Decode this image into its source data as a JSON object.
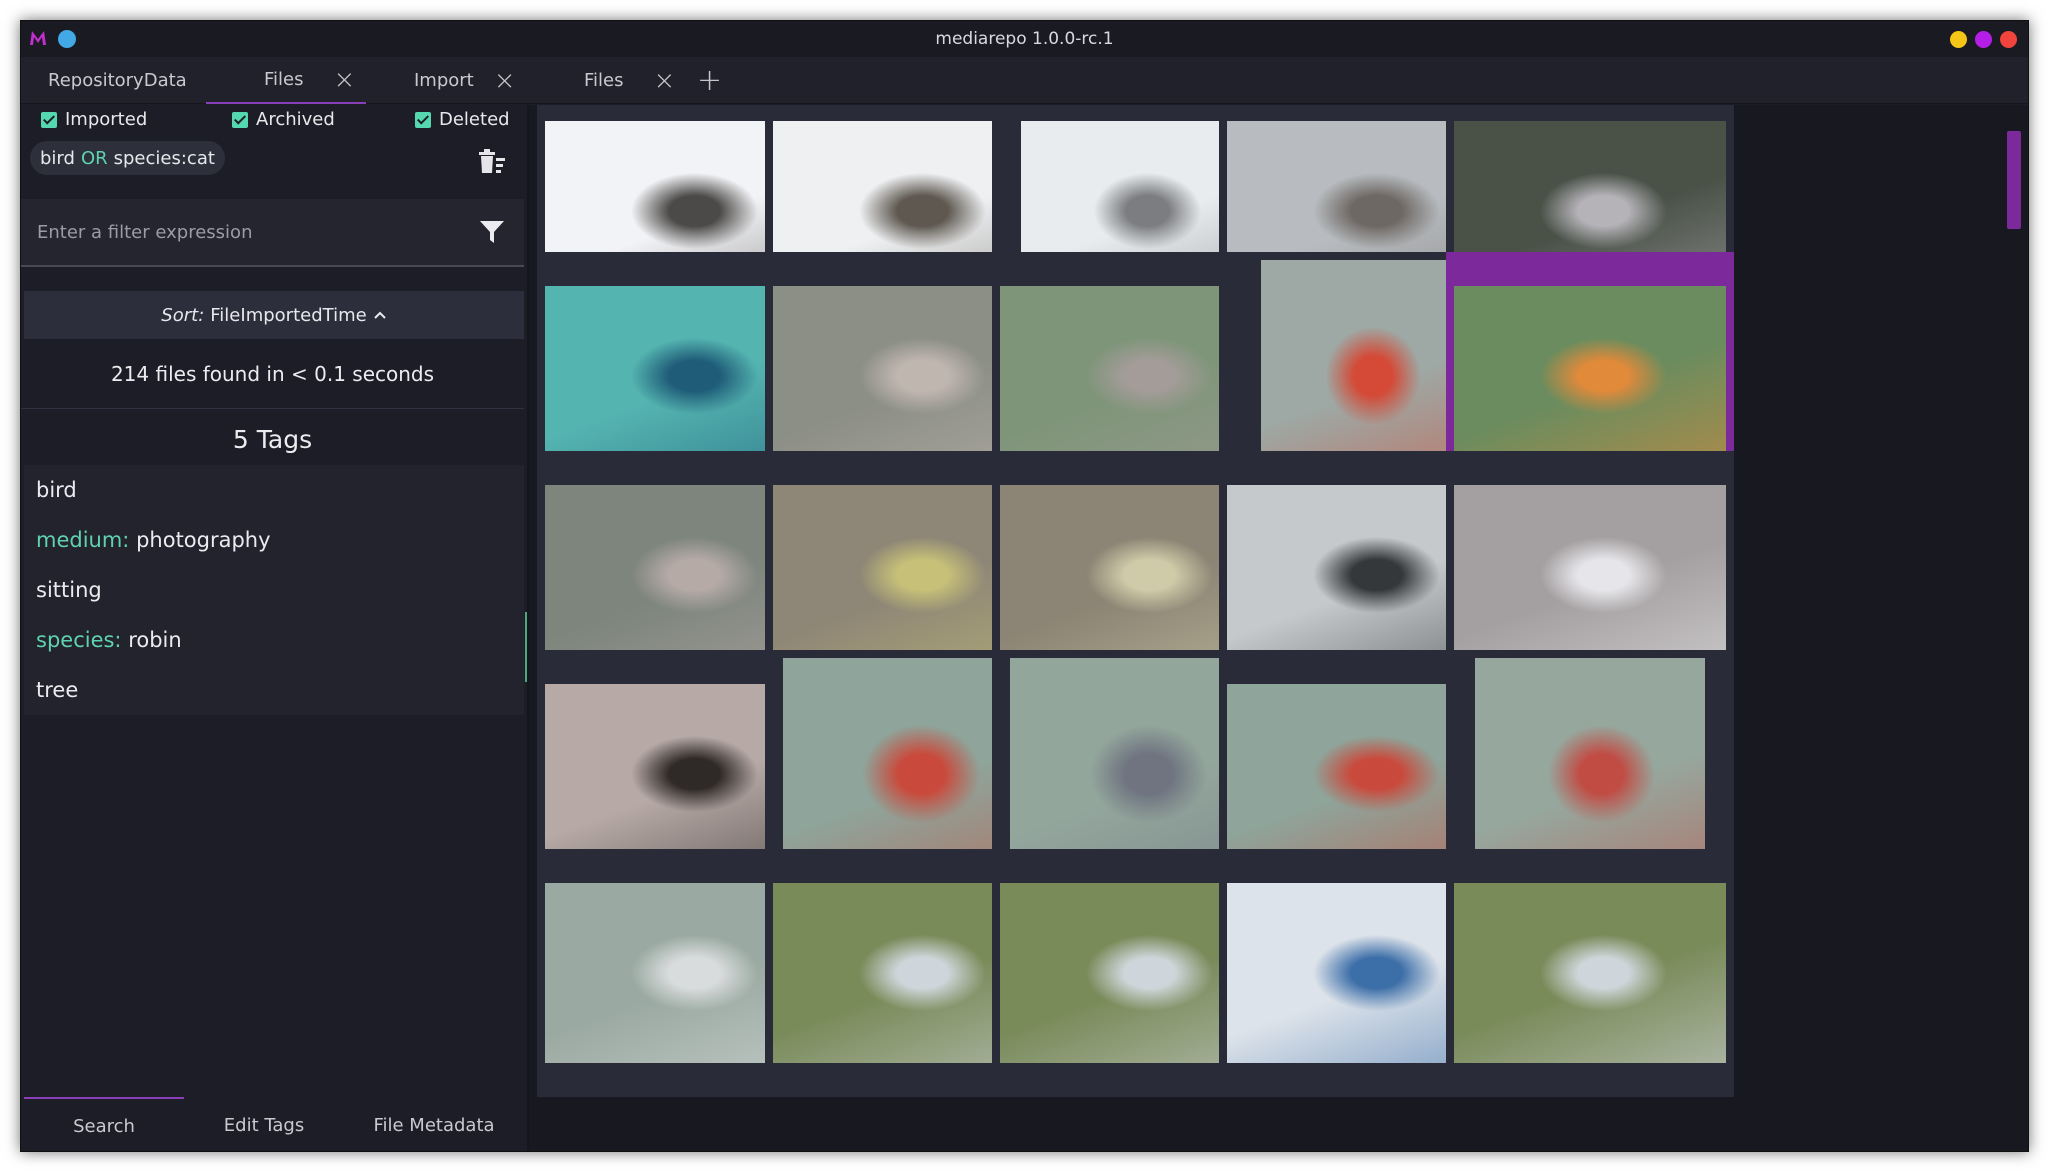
{
  "window": {
    "title": "mediarepo 1.0.0-rc.1",
    "controls": [
      {
        "name": "minimize-button",
        "color": "#f5c518"
      },
      {
        "name": "maximize-button",
        "color": "#b51ee6"
      },
      {
        "name": "close-button",
        "color": "#f0443c"
      }
    ]
  },
  "tabs": [
    {
      "label": "RepositoryData",
      "closable": false,
      "active": false
    },
    {
      "label": "Files",
      "closable": true,
      "active": true
    },
    {
      "label": "Import",
      "closable": true,
      "active": false
    },
    {
      "label": "Files",
      "closable": true,
      "active": false
    }
  ],
  "add_tab_icon": "plus-icon",
  "sidebar": {
    "filters": [
      {
        "label": "Imported",
        "checked": true
      },
      {
        "label": "Archived",
        "checked": true
      },
      {
        "label": "Deleted",
        "checked": true
      }
    ],
    "active_filter": {
      "left": "bird",
      "operator": "OR",
      "right": "species:cat"
    },
    "filter_input_placeholder": "Enter a filter expression",
    "sort": {
      "key": "Sort:",
      "value": "FileImportedTime",
      "direction_icon": "chevron-up-icon"
    },
    "result_count": "214 files found in < 0.1 seconds",
    "tags_heading": "5 Tags",
    "tags": [
      {
        "namespace": "",
        "name": "bird"
      },
      {
        "namespace": "medium:",
        "name": "photography"
      },
      {
        "namespace": "",
        "name": "sitting"
      },
      {
        "namespace": "species:",
        "name": "robin"
      },
      {
        "namespace": "",
        "name": "tree"
      }
    ],
    "bottom_tabs": [
      {
        "label": "Search",
        "active": true
      },
      {
        "label": "Edit Tags",
        "active": false
      },
      {
        "label": "File Metadata",
        "active": false
      }
    ]
  },
  "grid": {
    "selected_index": 9,
    "thumbnails": [
      {
        "subject": "blackbird in snow",
        "colors": [
          "#f2f3f6",
          "#4c4a48"
        ],
        "deleted": false
      },
      {
        "subject": "bird in snow close-up",
        "colors": [
          "#eef0f2",
          "#5e5850"
        ],
        "deleted": false
      },
      {
        "subject": "grey bird in snow",
        "colors": [
          "#e9ecef",
          "#7b7d80"
        ],
        "deleted": false
      },
      {
        "subject": "blackbird on snowy steps",
        "colors": [
          "#b8bcc0",
          "#6e6864"
        ],
        "deleted": false
      },
      {
        "subject": "ivy and snowy branches",
        "colors": [
          "#4a5248",
          "#b5b2b8"
        ],
        "deleted": false
      },
      {
        "subject": "blue bird on green",
        "colors": [
          "#54b4b0",
          "#1f5c78"
        ],
        "deleted": false
      },
      {
        "subject": "bird in bare branches",
        "colors": [
          "#8c8f86",
          "#c0b6b0"
        ],
        "deleted": false
      },
      {
        "subject": "thrush on branch",
        "colors": [
          "#7f957a",
          "#a39c98"
        ],
        "deleted": false
      },
      {
        "subject": "bullfinch in snowy bush",
        "colors": [
          "#9ea8a4",
          "#d44a36"
        ],
        "deleted": false
      },
      {
        "subject": "robin on mossy branch",
        "colors": [
          "#6b8c5e",
          "#e08a3a"
        ],
        "deleted": false
      },
      {
        "subject": "bird in bare branches",
        "colors": [
          "#7d857c",
          "#b5aaa6"
        ],
        "deleted": false
      },
      {
        "subject": "siskin on ground",
        "colors": [
          "#8e8676",
          "#c6c078"
        ],
        "deleted": false
      },
      {
        "subject": "chaffinch on ground",
        "colors": [
          "#8c8474",
          "#cfcaa8"
        ],
        "deleted": false
      },
      {
        "subject": "bird in bare tree",
        "colors": [
          "#c5c9cc",
          "#35383a"
        ],
        "deleted": false
      },
      {
        "subject": "snowy branches",
        "colors": [
          "#a49fa0",
          "#e6e6ea"
        ],
        "deleted": false
      },
      {
        "subject": "cat sleeping",
        "colors": [
          "#b7aaa6",
          "#2f2a28"
        ],
        "deleted": false
      },
      {
        "subject": "bullfinch in snowy bamboo",
        "colors": [
          "#8fa49a",
          "#c94a3c"
        ],
        "deleted": false
      },
      {
        "subject": "bird in snowy bamboo",
        "colors": [
          "#93a69c",
          "#6f7480"
        ],
        "deleted": true
      },
      {
        "subject": "bullfinch in snowy bamboo",
        "colors": [
          "#8fa49a",
          "#c94a3c"
        ],
        "deleted": false
      },
      {
        "subject": "bullfinch in snowy bamboo",
        "colors": [
          "#96a89e",
          "#c14c44"
        ],
        "deleted": false
      },
      {
        "subject": "snowy bamboo",
        "colors": [
          "#9aa9a1",
          "#d9dcdd"
        ],
        "deleted": false
      },
      {
        "subject": "branches",
        "colors": [
          "#7a8b5a",
          "#cfd6db"
        ],
        "deleted": false
      },
      {
        "subject": "branches",
        "colors": [
          "#7a8b5a",
          "#cfd6db"
        ],
        "deleted": false
      },
      {
        "subject": "snowy scene",
        "colors": [
          "#dde3ea",
          "#3c6ea8"
        ],
        "deleted": true
      },
      {
        "subject": "branches",
        "colors": [
          "#7a8b5a",
          "#cfd6db"
        ],
        "deleted": false
      }
    ]
  }
}
